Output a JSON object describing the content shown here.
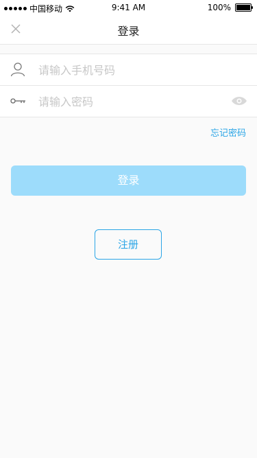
{
  "status_bar": {
    "carrier": "中国移动",
    "time": "9:41 AM",
    "battery": "100%",
    "battery_level": 1.0
  },
  "nav": {
    "title": "登录",
    "close_icon": "close-icon"
  },
  "form": {
    "phone": {
      "icon": "user-icon",
      "placeholder": "请输入手机号码",
      "value": ""
    },
    "password": {
      "icon": "key-icon",
      "placeholder": "请输入密码",
      "value": "",
      "toggle_icon": "eye-icon"
    }
  },
  "links": {
    "forgot_password": "忘记密码"
  },
  "buttons": {
    "login": "登录",
    "register": "注册"
  },
  "colors": {
    "accent": "#2aa5e6",
    "login_button": "#9ddcfb",
    "background": "#fafafa"
  }
}
